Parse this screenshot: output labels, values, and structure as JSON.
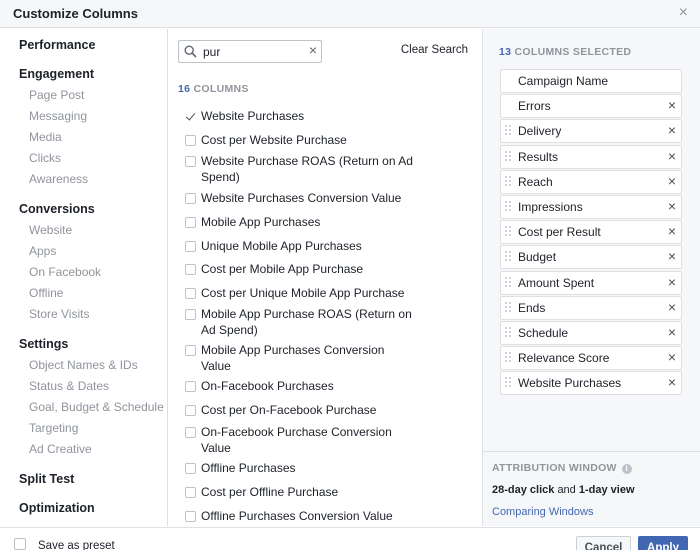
{
  "dialog": {
    "title": "Customize Columns",
    "close_icon": "close-icon"
  },
  "sidebar": {
    "sections": [
      {
        "label": "Performance",
        "items": []
      },
      {
        "label": "Engagement",
        "items": [
          "Page Post",
          "Messaging",
          "Media",
          "Clicks",
          "Awareness"
        ]
      },
      {
        "label": "Conversions",
        "items": [
          "Website",
          "Apps",
          "On Facebook",
          "Offline",
          "Store Visits"
        ]
      },
      {
        "label": "Settings",
        "items": [
          "Object Names & IDs",
          "Status & Dates",
          "Goal, Budget & Schedule",
          "Targeting",
          "Ad Creative"
        ]
      },
      {
        "label": "Split Test",
        "items": []
      },
      {
        "label": "Optimization",
        "items": []
      }
    ]
  },
  "search": {
    "value": "pur",
    "clear_label": "Clear Search",
    "icon": "search-icon"
  },
  "columns": {
    "count": "16",
    "count_suffix": "COLUMNS",
    "items": [
      {
        "label": "Website Purchases",
        "checked": true
      },
      {
        "label": "Cost per Website Purchase",
        "checked": false
      },
      {
        "label": "Website Purchase ROAS (Return on Ad Spend)",
        "checked": false
      },
      {
        "label": "Website Purchases Conversion Value",
        "checked": false
      },
      {
        "label": "Mobile App Purchases",
        "checked": false
      },
      {
        "label": "Unique Mobile App Purchases",
        "checked": false
      },
      {
        "label": "Cost per Mobile App Purchase",
        "checked": false
      },
      {
        "label": "Cost per Unique Mobile App Purchase",
        "checked": false
      },
      {
        "label": "Mobile App Purchase ROAS (Return on Ad Spend)",
        "checked": false
      },
      {
        "label": "Mobile App Purchases Conversion Value",
        "checked": false
      },
      {
        "label": "On-Facebook Purchases",
        "checked": false
      },
      {
        "label": "Cost per On-Facebook Purchase",
        "checked": false
      },
      {
        "label": "On-Facebook Purchase Conversion Value",
        "checked": false
      },
      {
        "label": "Offline Purchases",
        "checked": false
      },
      {
        "label": "Cost per Offline Purchase",
        "checked": false
      },
      {
        "label": "Offline Purchases Conversion Value",
        "checked": false
      }
    ]
  },
  "selected": {
    "count": "13",
    "count_suffix": "COLUMNS SELECTED",
    "items": [
      {
        "label": "Campaign Name",
        "removable": false,
        "draggable": false
      },
      {
        "label": "Errors",
        "removable": true,
        "draggable": false
      },
      {
        "label": "Delivery",
        "removable": true,
        "draggable": true
      },
      {
        "label": "Results",
        "removable": true,
        "draggable": true
      },
      {
        "label": "Reach",
        "removable": true,
        "draggable": true
      },
      {
        "label": "Impressions",
        "removable": true,
        "draggable": true
      },
      {
        "label": "Cost per Result",
        "removable": true,
        "draggable": true
      },
      {
        "label": "Budget",
        "removable": true,
        "draggable": true
      },
      {
        "label": "Amount Spent",
        "removable": true,
        "draggable": true
      },
      {
        "label": "Ends",
        "removable": true,
        "draggable": true
      },
      {
        "label": "Schedule",
        "removable": true,
        "draggable": true
      },
      {
        "label": "Relevance Score",
        "removable": true,
        "draggable": true
      },
      {
        "label": "Website Purchases",
        "removable": true,
        "draggable": true
      }
    ]
  },
  "attribution": {
    "label": "ATTRIBUTION WINDOW",
    "click_window": "28-day click",
    "joiner": "and",
    "view_window": "1-day view",
    "link": "Comparing Windows"
  },
  "footer": {
    "preset_label": "Save as preset",
    "cancel_label": "Cancel",
    "apply_label": "Apply"
  },
  "colors": {
    "accent": "#4267b2",
    "muted": "#90949c",
    "panel": "#f6f7f9",
    "border": "#dddfe2"
  }
}
